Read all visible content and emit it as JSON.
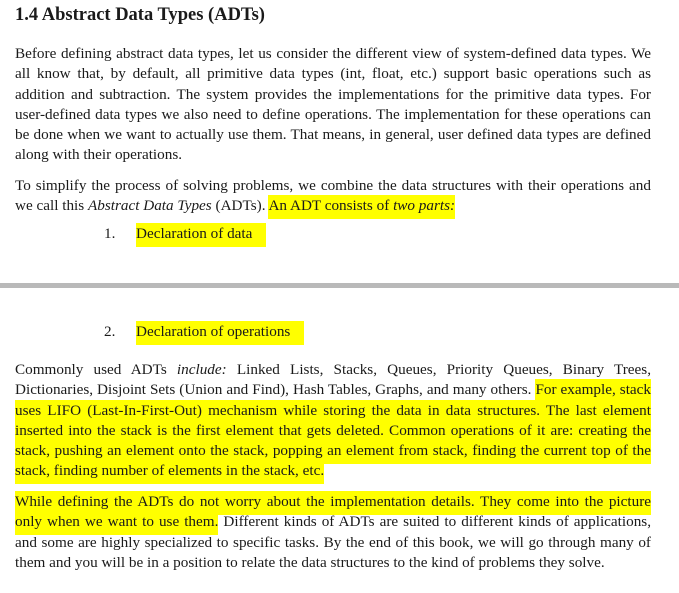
{
  "section": {
    "heading": "1.4 Abstract Data Types (ADTs)"
  },
  "paragraph1": "Before defining abstract data types, let us consider the different view of system-defined data types. We all know that, by default, all primitive data types (int, float, etc.) support basic operations such as addition and subtraction. The system provides the implementations for the primitive data types. For user-defined data types we also need to define operations. The implementation for these operations can be done when we want to actually use them. That means, in general, user defined data types are defined along with their operations.",
  "paragraph2": {
    "text_before_italic": "To simplify the process of solving problems, we combine the data structures with their operations and we call this ",
    "italic_term": "Abstract Data Types",
    "text_after_italic": " (ADTs). ",
    "highlighted_lead": "An ADT consists of ",
    "highlighted_italic": "two parts:"
  },
  "list": [
    {
      "number": "1.",
      "label": "Declaration of data"
    },
    {
      "number": "2.",
      "label": "Declaration of operations"
    }
  ],
  "paragraph3": {
    "lead": "Commonly used ADTs ",
    "italic_word": "include:",
    "plain_rest": " Linked Lists, Stacks, Queues, Priority Queues, Binary Trees, Dictionaries, Disjoint Sets (Union and Find), Hash Tables, Graphs, and many others. ",
    "highlighted": "For example, stack uses LIFO (Last-In-First-Out) mechanism while storing the data in data structures. The last element inserted into the stack is the first element that gets deleted. Common operations of it are: creating the stack, pushing an element onto the stack, popping an element from stack, finding the current top of the stack, finding number of elements in the stack, etc."
  },
  "paragraph4": {
    "highlighted": "While defining the ADTs do not worry about the implementation details. They come into the picture only when we want to use them.",
    "plain_rest": " Different kinds of ADTs are suited to different kinds of applications, and some are highly specialized to specific tasks. By the end of this book, we will go through many of them and you will be in a position to relate the data structures to the kind of problems they solve."
  },
  "colors": {
    "highlight": "#ffff00",
    "page_divider": "#b9b9b9",
    "text": "#1a1a1a"
  }
}
